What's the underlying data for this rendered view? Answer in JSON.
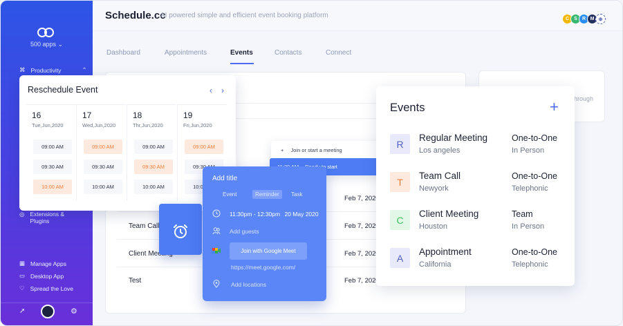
{
  "header": {
    "brand": "Schedule.cc",
    "tagline": "AI powered simple and efficient event booking platform",
    "team_avatars": [
      {
        "initial": "C",
        "color": "#f5b800"
      },
      {
        "initial": "S",
        "color": "#35b86e"
      },
      {
        "initial": "R",
        "color": "#2a8ff0"
      },
      {
        "initial": "M",
        "color": "#24305e"
      }
    ]
  },
  "sidebar": {
    "apps_label": "500 apps",
    "section": "Productivity",
    "items_bottom": [
      {
        "label": "Extensions & Plugins"
      },
      {
        "label": "Manage Apps"
      },
      {
        "label": "Desktop App"
      },
      {
        "label": "Spread the Love"
      }
    ]
  },
  "tabs": [
    "Dashboard",
    "Appointments",
    "Events",
    "Contacts",
    "Connect"
  ],
  "table": {
    "rows": [
      {
        "name": "",
        "date": "Feb 7, 2020"
      },
      {
        "name": "Team Call",
        "date": "Feb 7, 2020"
      },
      {
        "name": "Client Meeting",
        "date": "Feb 7, 2020"
      },
      {
        "name": "Test",
        "date": "Feb 7, 2020"
      }
    ],
    "behind_text": "hrough"
  },
  "reschedule": {
    "title": "Reschedule Event",
    "prev": "‹",
    "next": "›",
    "days": [
      {
        "num": "16",
        "label": "Tue,Jun,2020",
        "slots": [
          "09:00 AM",
          "09:30 AM",
          "10:00 AM"
        ]
      },
      {
        "num": "17",
        "label": "Wed,Jun,2020",
        "slots": [
          "09:00 AM",
          "09:30 AM",
          "10:00 AM"
        ]
      },
      {
        "num": "18",
        "label": "Thr,Jun,2020",
        "slots": [
          "09:00 AM",
          "09:30 AM",
          "10:00 AM"
        ]
      },
      {
        "num": "19",
        "label": "Fri,Jun,2020",
        "slots": [
          "09:00 AM",
          "09:30 AM",
          "10:00 AM"
        ]
      }
    ]
  },
  "meet_menu": {
    "item": "Join or start a meeting",
    "selected_time": "11:30 AM",
    "selected_label": "Ready to start"
  },
  "add_title": {
    "title": "Add title",
    "segments": [
      "Event",
      "Reminder",
      "Task"
    ],
    "time": "11:30pm - 12:30pm",
    "date": "20 May 2020",
    "guests": "Add guests",
    "join_button": "Join with Google Meet",
    "meet_url": "https://meet.google.com/",
    "locations": "Add locations"
  },
  "events": {
    "title": "Events",
    "add": "+",
    "items": [
      {
        "badge": "R",
        "badge_bg": "#e8eafb",
        "badge_fg": "#5060c8",
        "title": "Regular Meeting",
        "place": "Los angeles",
        "type": "One-to-One",
        "mode": "In Person"
      },
      {
        "badge": "T",
        "badge_bg": "#fde9dd",
        "badge_fg": "#f07e3a",
        "title": "Team Call",
        "place": "Newyork",
        "type": "One-to-One",
        "mode": "Telephonic"
      },
      {
        "badge": "C",
        "badge_bg": "#e2f7e6",
        "badge_fg": "#3cc15a",
        "title": "Client Meeting",
        "place": "Houston",
        "type": "Team",
        "mode": "In Person"
      },
      {
        "badge": "A",
        "badge_bg": "#e8eafb",
        "badge_fg": "#5060c8",
        "title": "Appointment",
        "place": "California",
        "type": "One-to-One",
        "mode": "Telephonic"
      }
    ]
  }
}
